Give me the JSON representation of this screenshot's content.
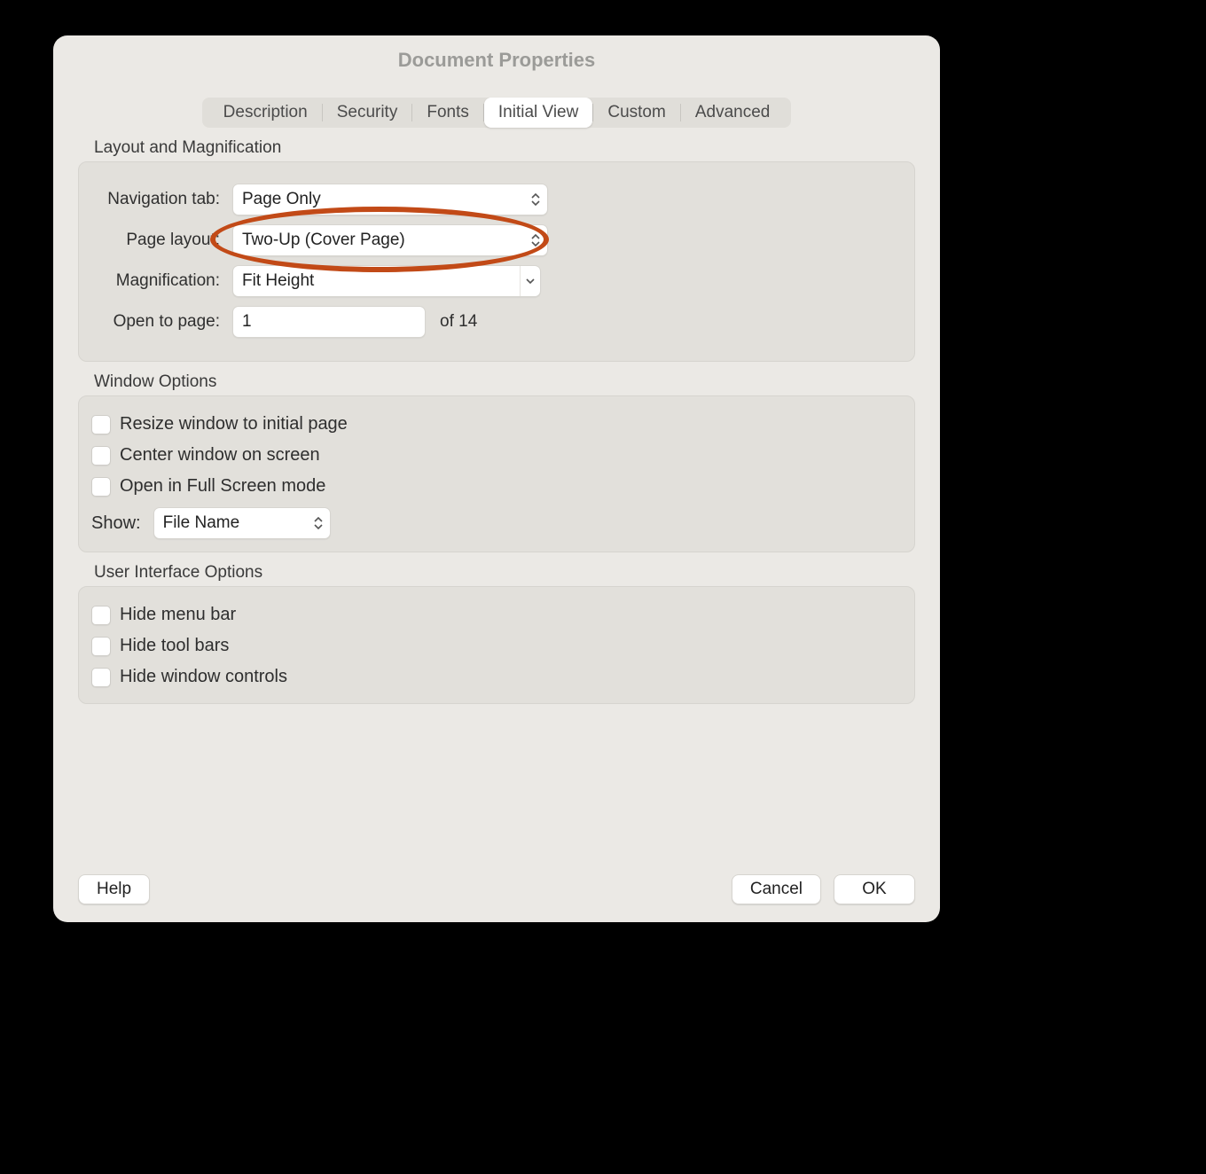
{
  "window": {
    "title": "Document Properties"
  },
  "tabs": [
    "Description",
    "Security",
    "Fonts",
    "Initial View",
    "Custom",
    "Advanced"
  ],
  "sections": {
    "layout": {
      "title": "Layout and Magnification",
      "nav_tab_label": "Navigation tab:",
      "nav_tab_value": "Page Only",
      "page_layout_label": "Page layout:",
      "page_layout_value": "Two-Up (Cover Page)",
      "magnification_label": "Magnification:",
      "magnification_value": "Fit Height",
      "open_to_page_label": "Open to page:",
      "open_to_page_value": "1",
      "page_count_text": "of 14"
    },
    "window": {
      "title": "Window Options",
      "resize": "Resize window to initial page",
      "center": "Center window on screen",
      "fullscreen": "Open in Full Screen mode",
      "show_label": "Show:",
      "show_value": "File Name"
    },
    "ui": {
      "title": "User Interface Options",
      "hide_menu": "Hide menu bar",
      "hide_toolbars": "Hide tool bars",
      "hide_window_controls": "Hide window controls"
    }
  },
  "footer": {
    "help": "Help",
    "cancel": "Cancel",
    "ok": "OK"
  }
}
